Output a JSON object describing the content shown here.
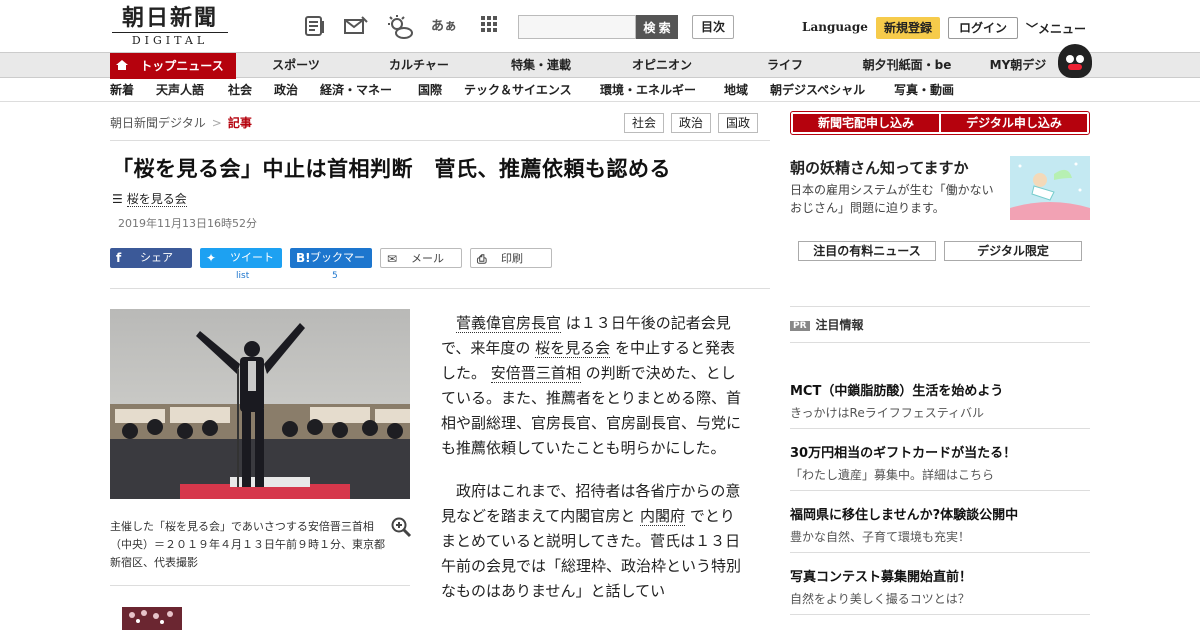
{
  "header": {
    "logo_main": "朝日新聞",
    "logo_sub": "DIGITAL",
    "search_button": "検 索",
    "search_placeholder": "",
    "index_button": "目次",
    "language": "Language",
    "register": "新規登録",
    "login": "ログイン",
    "menu": "メニュー",
    "font_icon_text": "あぁ"
  },
  "nav_main": [
    "トップニュース",
    "スポーツ",
    "カルチャー",
    "特集・連載",
    "オピニオン",
    "ライフ",
    "朝夕刊紙面・be",
    "MY朝デジ"
  ],
  "nav_sub": [
    "新着",
    "天声人語",
    "社会",
    "政治",
    "経済・マネー",
    "国際",
    "テック＆サイエンス",
    "環境・エネルギー",
    "地域",
    "朝デジスペシャル",
    "写真・動画"
  ],
  "breadcrumb": {
    "home": "朝日新聞デジタル",
    "sep": ">",
    "current": "記事"
  },
  "tags": [
    "社会",
    "政治",
    "国政"
  ],
  "article": {
    "headline": "「桜を見る会」中止は首相判断　菅氏、推薦依頼も認める",
    "topic": "桜を見る会",
    "date": "2019年11月13日16時52分",
    "share": {
      "facebook": "シェア",
      "twitter": "ツイート",
      "twitter_count": "list",
      "hatena": "ブックマーク",
      "hatena_count": "5",
      "mail": "メール",
      "print": "印刷"
    },
    "caption": "主催した「桜を見る会」であいさつする安倍晋三首相（中央）＝２０１９年４月１３日午前９時１分、東京都新宿区、代表撮影",
    "p1": {
      "link1": "菅義偉官房長官",
      "t1": " は１３日午後の記者会見で、来年度の ",
      "link2": "桜を見る会",
      "t2": " を中止すると発表した。 ",
      "link3": "安倍晋三首相",
      "t3": " の判断で決めた、としている。また、推薦者をとりまとめる際、首相や副総理、官房長官、官房副長官、与党にも推薦依頼していたことも明らかにした。"
    },
    "p2": {
      "t1": "政府はこれまで、招待者は各省庁からの意見などを踏まえて内閣官房と ",
      "link1": "内閣府",
      "t2": " でとりまとめていると説明してきた。菅氏は１３日午前の会見では「総理枠、政治枠という特別なものはありません」と話してい"
    }
  },
  "sidebar": {
    "subscribe_paper": "新聞宅配申し込み",
    "subscribe_digital": "デジタル申し込み",
    "promo_title": "朝の妖精さん知ってますか",
    "promo_desc": "日本の雇用システムが生む「働かないおじさん」問題に迫ります。",
    "pick_paid": "注目の有料ニュース",
    "pick_digital": "デジタル限定",
    "pr_badge": "PR",
    "pr_heading": "注目情報",
    "pr_items": [
      {
        "title": "MCT（中鎖脂肪酸）生活を始めよう",
        "desc": "きっかけはReライフフェスティバル"
      },
      {
        "title": "30万円相当のギフトカードが当たる！",
        "desc": "「わたし遺産」募集中。詳細はこちら"
      },
      {
        "title": "福岡県に移住しませんか?体験談公開中",
        "desc": "豊かな自然、子育て環境も充実！"
      },
      {
        "title": "写真コンテスト募集開始直前！",
        "desc": "自然をより美しく撮るコツとは？"
      }
    ]
  },
  "colors": {
    "brand_red": "#b5020d",
    "register_yellow": "#f6cb4b",
    "facebook": "#3b5998",
    "twitter": "#1da1f2",
    "hatena": "#1d76ce"
  }
}
